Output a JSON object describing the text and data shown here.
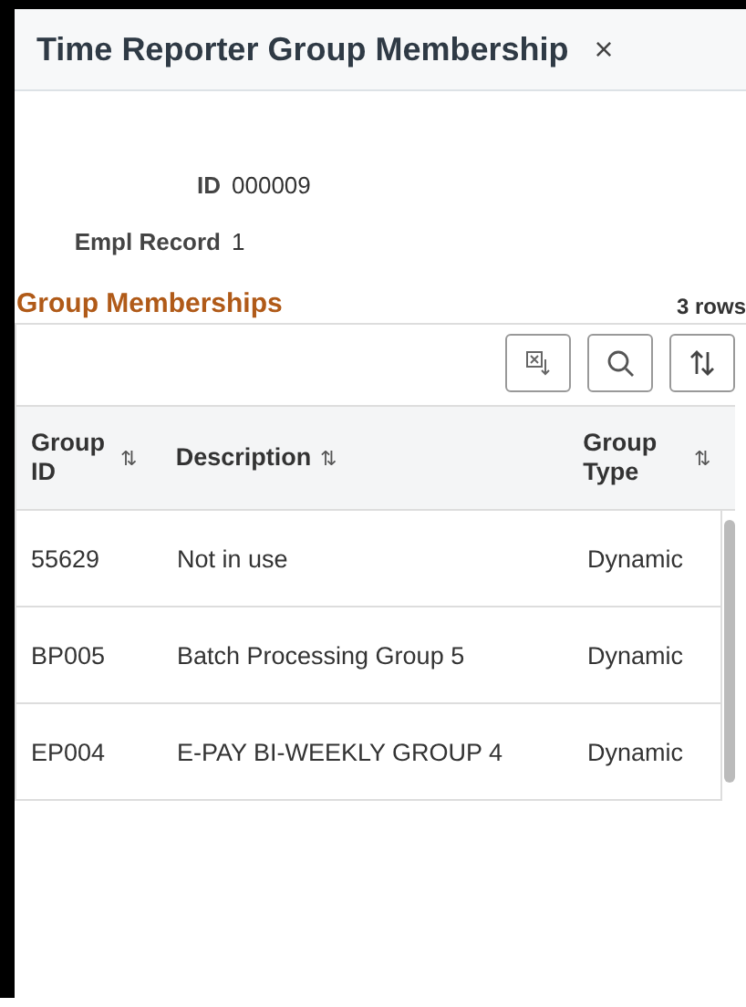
{
  "window": {
    "title": "Time Reporter Group Membership",
    "close": "×"
  },
  "fields": [
    {
      "label": "ID",
      "value": "000009"
    },
    {
      "label": "Empl Record",
      "value": "1"
    }
  ],
  "grid": {
    "title": "Group Memberships",
    "row_count": "3 rows",
    "columns": [
      {
        "label": "Group ID",
        "sort": "⇅"
      },
      {
        "label": "Description",
        "sort": "⇅"
      },
      {
        "label": "Group Type",
        "sort": "⇅"
      }
    ],
    "rows": [
      [
        "55629",
        "Not in use",
        "Dynamic"
      ],
      [
        "BP005",
        "Batch Processing Group 5",
        "Dynamic"
      ],
      [
        "EP004",
        "E-PAY BI-WEEKLY GROUP 4",
        "Dynamic"
      ]
    ]
  }
}
